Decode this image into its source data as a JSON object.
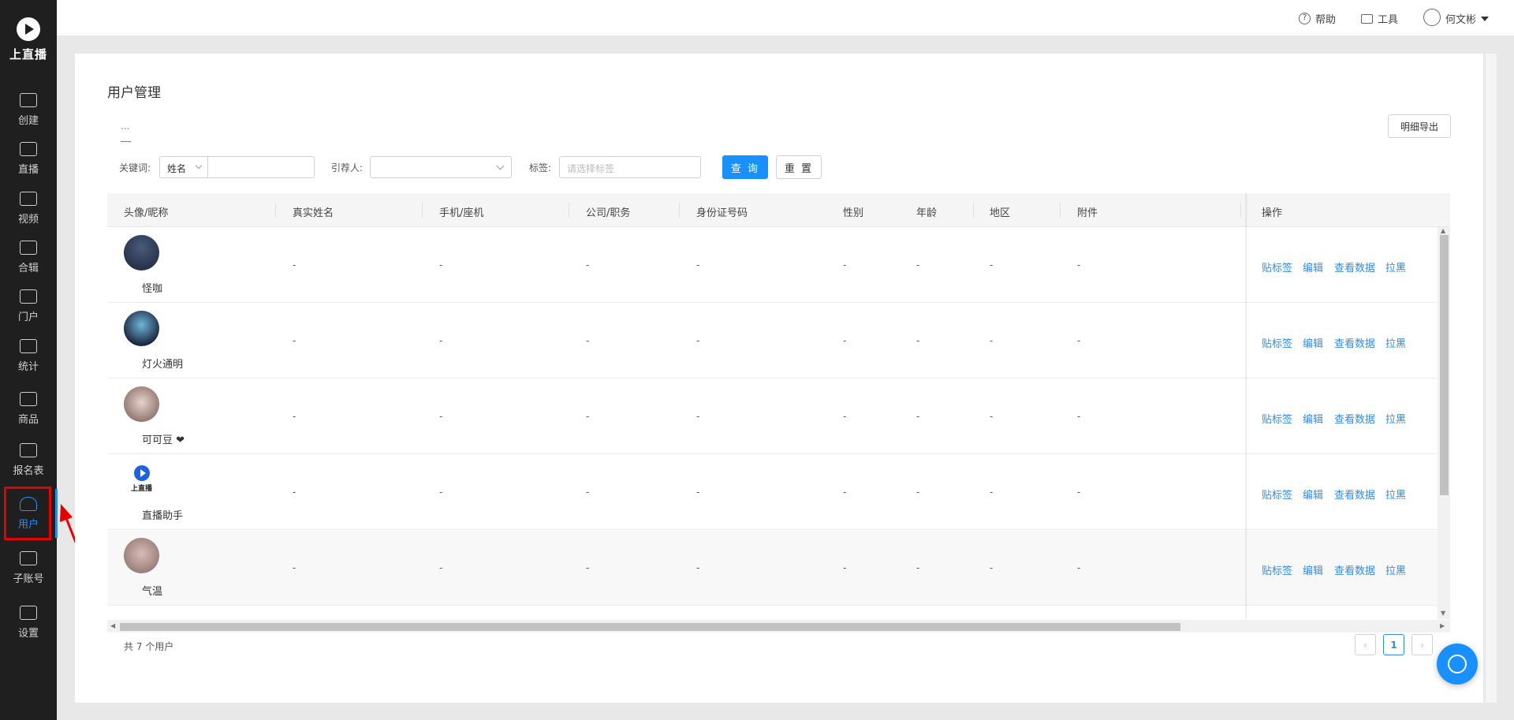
{
  "app": {
    "logo_text": "上直播"
  },
  "sidebar": {
    "items": [
      {
        "label": "创建",
        "icon": "plus-square-icon"
      },
      {
        "label": "直播",
        "icon": "play-screen-icon"
      },
      {
        "label": "视频",
        "icon": "video-icon"
      },
      {
        "label": "合辑",
        "icon": "wallet-icon"
      },
      {
        "label": "门户",
        "icon": "grid-icon"
      },
      {
        "label": "统计",
        "icon": "chart-line-icon"
      },
      {
        "label": "商品",
        "icon": "bag-icon"
      },
      {
        "label": "报名表",
        "icon": "form-icon"
      },
      {
        "label": "用户",
        "icon": "user-icon",
        "active": true
      },
      {
        "label": "子账号",
        "icon": "sub-account-icon"
      },
      {
        "label": "设置",
        "icon": "gear-icon"
      }
    ]
  },
  "topbar": {
    "help": "帮助",
    "tools": "工具",
    "user_name": "何文彬"
  },
  "page": {
    "title": "用户管理",
    "tab_label": "...",
    "export_button": "明细导出"
  },
  "filters": {
    "keyword_label": "关键词:",
    "keyword_type": "姓名",
    "keyword_value": "",
    "referrer_label": "引荐人:",
    "referrer_value": "",
    "tag_label": "标签:",
    "tag_placeholder": "请选择标签",
    "query_button": "查 询",
    "reset_button": "重 置"
  },
  "table": {
    "headers": [
      "头像/昵称",
      "真实姓名",
      "手机/座机",
      "公司/职务",
      "身份证号码",
      "性别",
      "年龄",
      "地区",
      "附件",
      "操作"
    ],
    "rows": [
      {
        "nickname": "怪咖",
        "real_name": "-",
        "phone": "-",
        "company": "-",
        "id_number": "-",
        "gender": "-",
        "age": "-",
        "region": "-",
        "attachment": "-"
      },
      {
        "nickname": "灯火通明",
        "real_name": "-",
        "phone": "-",
        "company": "-",
        "id_number": "-",
        "gender": "-",
        "age": "-",
        "region": "-",
        "attachment": "-"
      },
      {
        "nickname": "可可豆 ❤",
        "real_name": "-",
        "phone": "-",
        "company": "-",
        "id_number": "-",
        "gender": "-",
        "age": "-",
        "region": "-",
        "attachment": "-"
      },
      {
        "nickname": "直播助手",
        "real_name": "-",
        "phone": "-",
        "company": "-",
        "id_number": "-",
        "gender": "-",
        "age": "-",
        "region": "-",
        "attachment": "-",
        "avatar_logo_text": "上直播"
      },
      {
        "nickname": "气温",
        "real_name": "-",
        "phone": "-",
        "company": "-",
        "id_number": "-",
        "gender": "-",
        "age": "-",
        "region": "-",
        "attachment": "-"
      }
    ],
    "actions": [
      "贴标签",
      "编辑",
      "查看数据",
      "拉黑"
    ]
  },
  "footer": {
    "total_text": "共 7 个用户",
    "current_page": "1"
  },
  "colors": {
    "accent": "#1890ff",
    "link": "#2d8cf0",
    "sidebar_bg": "#1f1f1f",
    "highlight_red": "#e60000"
  }
}
